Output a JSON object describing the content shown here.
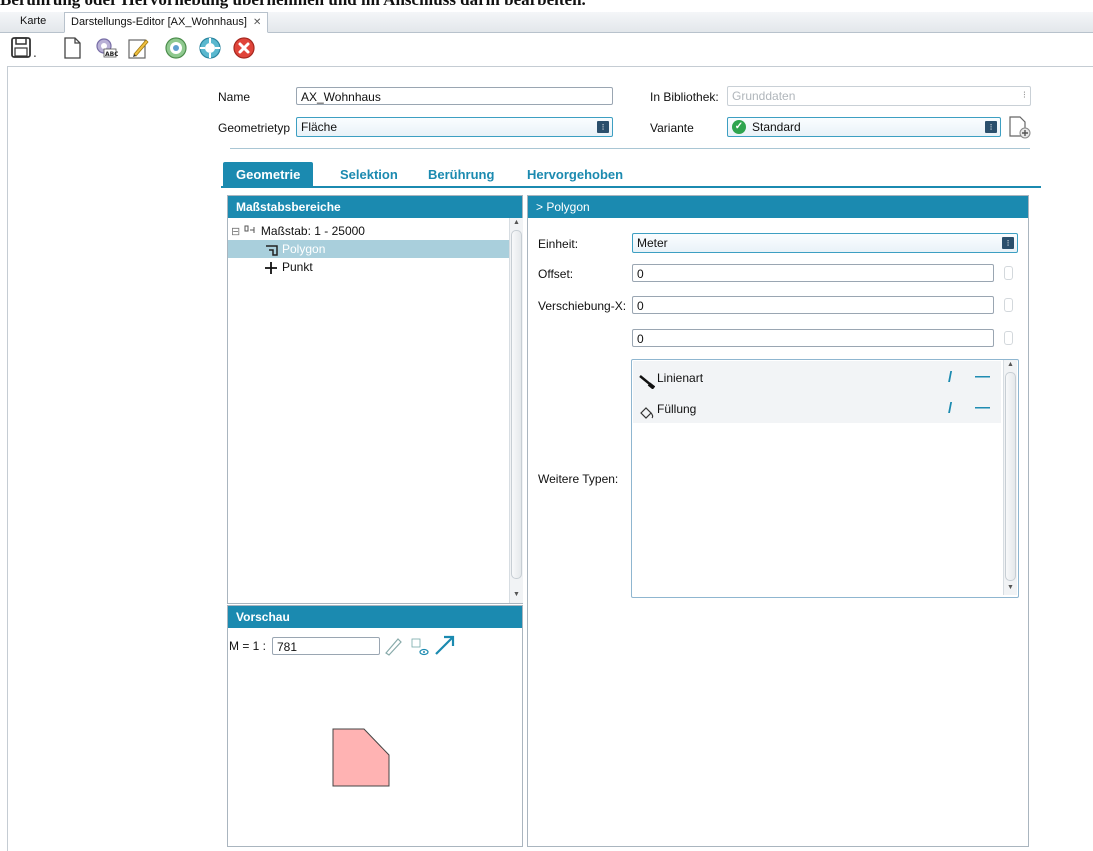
{
  "banner": {
    "text": "Berührung oder Hervorhebung übernehmen und im Anschluss darin bearbeiten."
  },
  "doc_tabs": [
    {
      "label": "Karte"
    },
    {
      "label": "Darstellungs-Editor [AX_Wohnhaus]"
    }
  ],
  "close_glyph": "✕",
  "toolbar": {
    "icons": [
      "save-icon",
      "new-document-icon",
      "search-abc-icon",
      "edit-icon",
      "refresh-settings-icon",
      "add-circle-icon",
      "delete-circle-icon"
    ]
  },
  "form": {
    "name_label": "Name",
    "name_value": "AX_Wohnhaus",
    "library_label": "In Bibliothek:",
    "library_value": "Grunddaten",
    "geomtype_label": "Geometrietyp",
    "geomtype_value": "Fläche",
    "variant_label": "Variante",
    "variant_value": "Standard"
  },
  "tabs": [
    {
      "label": "Geometrie",
      "active": true
    },
    {
      "label": "Selektion"
    },
    {
      "label": "Berührung"
    },
    {
      "label": "Hervorgehoben"
    }
  ],
  "scales_panel": {
    "title": "Maßstabsbereiche",
    "tree": {
      "collapse_glyph": "⊟",
      "scale_label": "Maßstab: 1 - 25000",
      "items": [
        {
          "label": "Polygon",
          "selected": true
        },
        {
          "label": "Punkt"
        }
      ]
    }
  },
  "preview_panel": {
    "title": "Vorschau",
    "scale_prefix": "M = 1 :",
    "scale_value": "781"
  },
  "polygon_panel": {
    "title": ">   Polygon",
    "unit_label": "Einheit:",
    "unit_value": "Meter",
    "offset_label": "Offset:",
    "offset_value": "0",
    "shiftx_label": "Verschiebung-X:",
    "shiftx_value": "0",
    "shifty_value": "0",
    "types_label": "Weitere Typen:",
    "types": [
      {
        "label": "Linienart",
        "icon": "brush-icon"
      },
      {
        "label": "Füllung",
        "icon": "fill-bucket-icon"
      }
    ],
    "edit_glyph": "/",
    "remove_glyph": "—"
  },
  "colors": {
    "accent": "#1b8ab0",
    "preview_fill": "#ffb3b3"
  }
}
